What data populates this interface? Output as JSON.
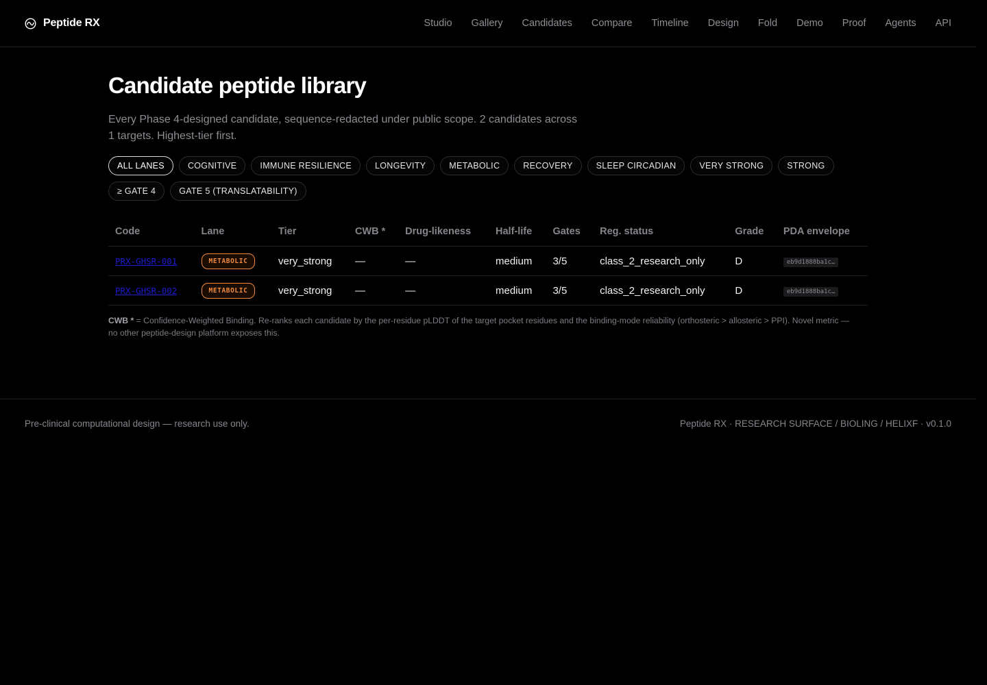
{
  "header": {
    "brand": "Peptide RX",
    "brand_icon": "wave-circle-icon",
    "nav": [
      "Studio",
      "Gallery",
      "Candidates",
      "Compare",
      "Timeline",
      "Design",
      "Fold",
      "Demo",
      "Proof",
      "Agents",
      "API"
    ]
  },
  "page": {
    "title": "Candidate peptide library",
    "subtitle": "Every Phase 4-designed candidate, sequence-redacted under public scope. 2 candidates across 1 targets. Highest-tier first."
  },
  "filters": {
    "active": "ALL LANES",
    "chips": [
      "ALL LANES",
      "COGNITIVE",
      "IMMUNE RESILIENCE",
      "LONGEVITY",
      "METABOLIC",
      "RECOVERY",
      "SLEEP CIRCADIAN",
      "VERY STRONG",
      "STRONG",
      "≥ GATE 4",
      "GATE 5 (TRANSLATABILITY)"
    ]
  },
  "table": {
    "columns": [
      "Code",
      "Lane",
      "Tier",
      "CWB *",
      "Drug-likeness",
      "Half-life",
      "Gates",
      "Reg. status",
      "Grade",
      "PDA envelope"
    ],
    "rows": [
      {
        "code": "PRX-GHSR-001",
        "lane": "METABOLIC",
        "tier": "very_strong",
        "cwb": "—",
        "drug_likeness": "—",
        "half_life": "medium",
        "gates": "3/5",
        "reg_status": "class_2_research_only",
        "grade": "D",
        "pda_envelope": "eb9d1888ba1c…"
      },
      {
        "code": "PRX-GHSR-002",
        "lane": "METABOLIC",
        "tier": "very_strong",
        "cwb": "—",
        "drug_likeness": "—",
        "half_life": "medium",
        "gates": "3/5",
        "reg_status": "class_2_research_only",
        "grade": "D",
        "pda_envelope": "eb9d1888ba1c…"
      }
    ]
  },
  "footnote": {
    "term": "CWB *",
    "text": " = Confidence-Weighted Binding. Re-ranks each candidate by the per-residue pLDDT of the target pocket residues and the binding-mode reliability (orthosteric > allosteric > PPI). Novel metric — no other peptide-design platform exposes this."
  },
  "footer": {
    "left": "Pre-clinical computational design — research use only.",
    "right": "Peptide RX · RESEARCH SURFACE / BIOLING / HELIXF · v0.1.0"
  },
  "colors": {
    "background": "#000000",
    "lane_metabolic": "#f08a3e",
    "code_link": "#1c1cd0"
  }
}
